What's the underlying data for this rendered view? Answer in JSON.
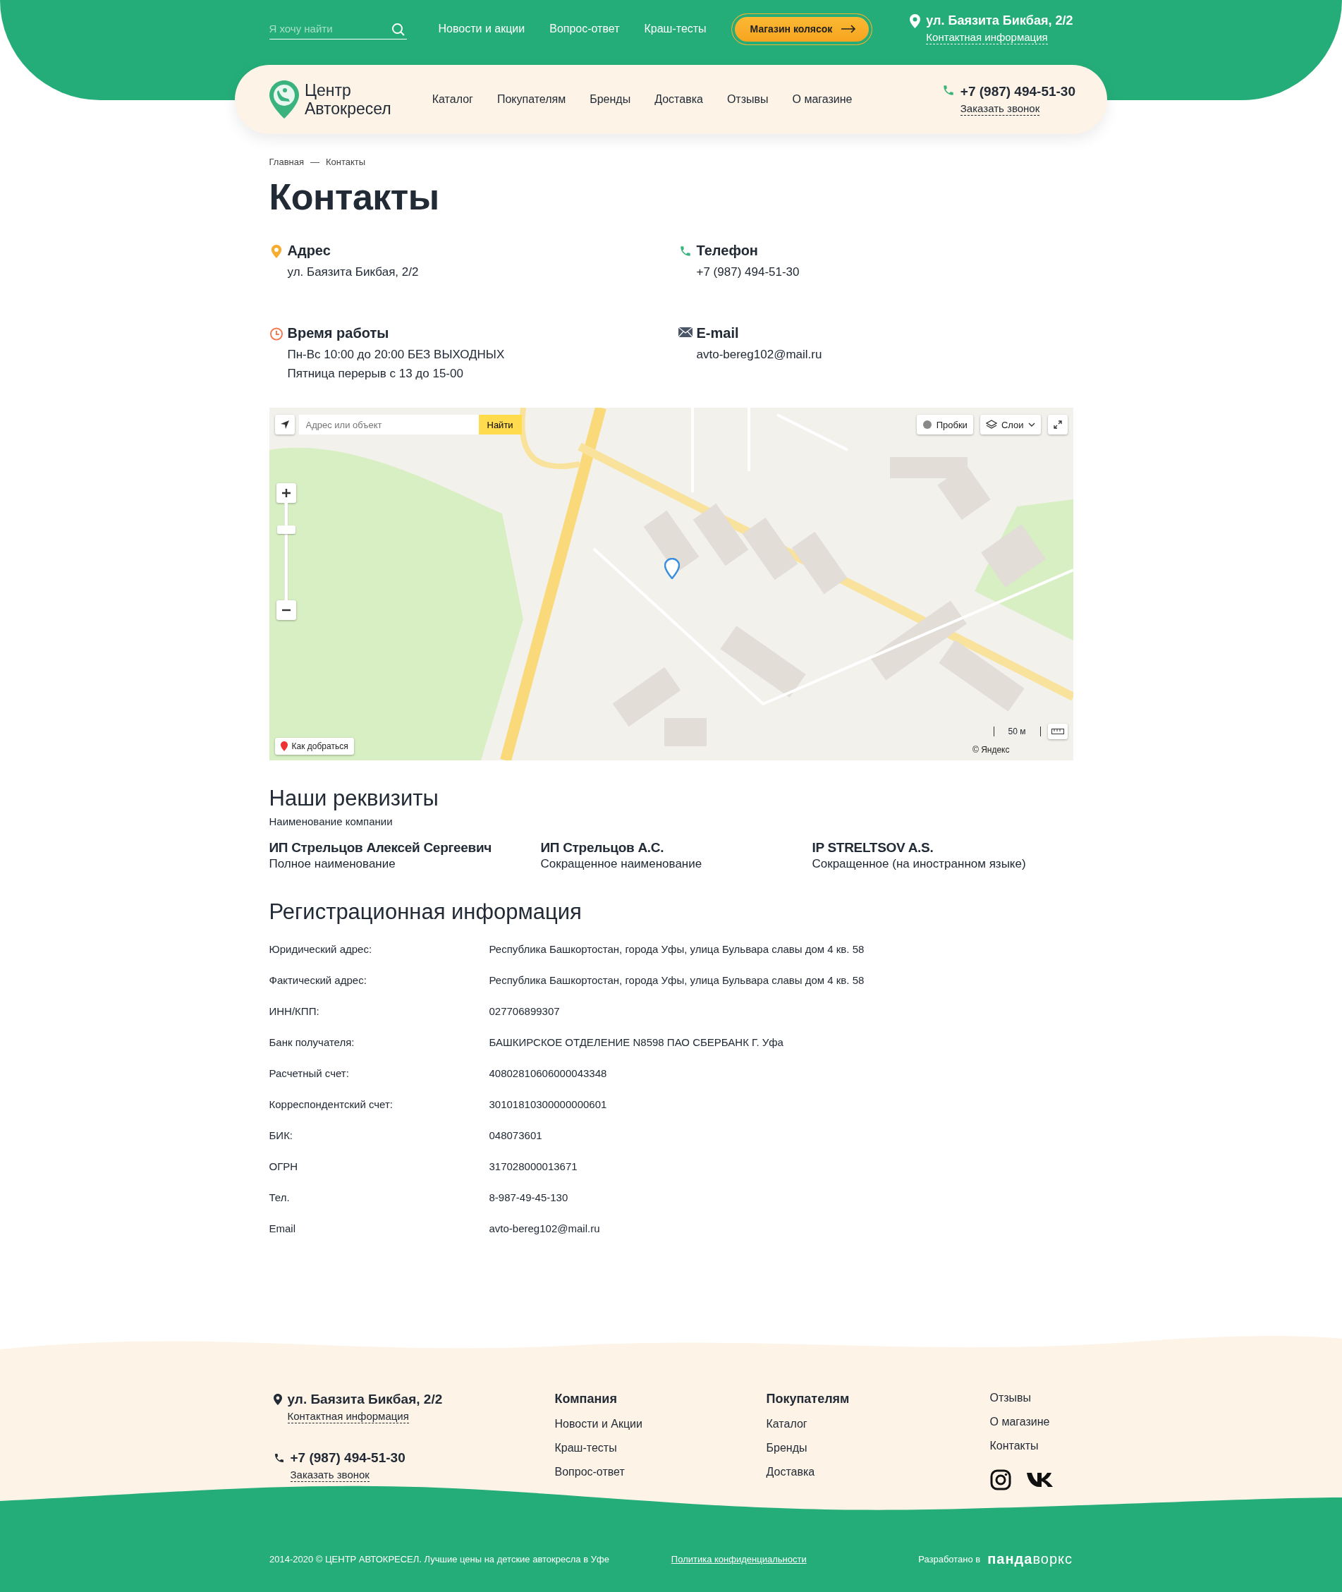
{
  "top_bar": {
    "search": {
      "placeholder": "Я хочу найти"
    },
    "links": [
      "Новости и акции",
      "Вопрос-ответ",
      "Краш-тесты"
    ],
    "stroller_button": "Магазин колясок",
    "address": "ул. Баязита Бикбая, 2/2",
    "contact_link": "Контактная информация"
  },
  "header": {
    "logo": [
      "Центр",
      "Автокресел"
    ],
    "nav": [
      "Каталог",
      "Покупателям",
      "Бренды",
      "Доставка",
      "Отзывы",
      "О магазине"
    ],
    "phone": "+7 (987) 494-51-30",
    "callback": "Заказать звонок"
  },
  "breadcrumbs": {
    "items": [
      "Главная",
      "Контакты"
    ],
    "separator": "—"
  },
  "title": "Контакты",
  "contacts": [
    {
      "kind": "address",
      "title": "Адрес",
      "lines": [
        "ул. Баязита Бикбая, 2/2"
      ]
    },
    {
      "kind": "phone",
      "title": "Телефон",
      "lines": [
        "+7 (987) 494-51-30"
      ]
    },
    {
      "kind": "hours",
      "title": "Время работы",
      "lines": [
        "Пн-Вс 10:00 до 20:00 БЕЗ ВЫХОДНЫХ",
        "Пятница перерыв с 13 до 15-00"
      ]
    },
    {
      "kind": "email",
      "title": "E-mail",
      "lines": [
        "avto-bereg102@mail.ru"
      ]
    }
  ],
  "map": {
    "search_placeholder": "Адрес или объект",
    "search_button": "Найти",
    "traffic_button": "Пробки",
    "layers_button": "Слои",
    "route_button": "Как добраться",
    "scale": "50 м",
    "zoom": {
      "level": 0.75
    },
    "copyright": "© Яндекс"
  },
  "requisites": {
    "title": "Наши реквизиты",
    "subtitle": "Наименование компании",
    "companies": [
      {
        "name": "ИП Стрельцов Алексей Сергеевич",
        "caption": "Полное наименование"
      },
      {
        "name": "ИП Стрельцов А.С.",
        "caption": "Сокращенное наименование"
      },
      {
        "name": "IP STRELTSOV A.S.",
        "caption": "Сокращенное (на иностранном языке)"
      }
    ]
  },
  "registration": {
    "title": "Регистрационная информация",
    "rows": [
      {
        "label": "Юридический адрес:",
        "value": "Республика Башкортостан, города Уфы, улица Бульвара славы дом 4 кв. 58"
      },
      {
        "label": "Фактический адрес:",
        "value": "Республика Башкортостан, города Уфы, улица Бульвара славы дом 4 кв. 58"
      },
      {
        "label": "ИНН/КПП:",
        "value": "027706899307"
      },
      {
        "label": "Банк получателя:",
        "value": "БАШКИРСКОЕ ОТДЕЛЕНИЕ N8598 ПАО СБЕРБАНК Г. Уфа"
      },
      {
        "label": "Расчетный счет:",
        "value": "40802810606000043348"
      },
      {
        "label": "Корреспондентский счет:",
        "value": "30101810300000000601"
      },
      {
        "label": "БИК:",
        "value": "048073601"
      },
      {
        "label": "ОГРН",
        "value": "317028000013671"
      },
      {
        "label": "Тел.",
        "value": "8-987-49-45-130"
      },
      {
        "label": "Email",
        "value": "avto-bereg102@mail.ru"
      }
    ]
  },
  "footer": {
    "address": "ул. Баязита Бикбая, 2/2",
    "contact_link": "Контактная информация",
    "phone": "+7 (987) 494-51-30",
    "callback": "Заказать звонок",
    "columns": [
      {
        "title": "Компания",
        "links": [
          "Новости и Акции",
          "Краш-тесты",
          "Вопрос-ответ"
        ]
      },
      {
        "title": "Покупателям",
        "links": [
          "Каталог",
          "Бренды",
          "Доставка"
        ]
      }
    ],
    "extra_links": [
      "Отзывы",
      "О магазине",
      "Контакты"
    ],
    "copyright": "2014-2020 © ЦЕНТР АВТОКРЕСЕЛ. Лучшие цены на детские автокресла в Уфе",
    "privacy": "Политика конфиденциальности",
    "developed_by": "Разработано в",
    "developer": "**панда**воркс"
  }
}
